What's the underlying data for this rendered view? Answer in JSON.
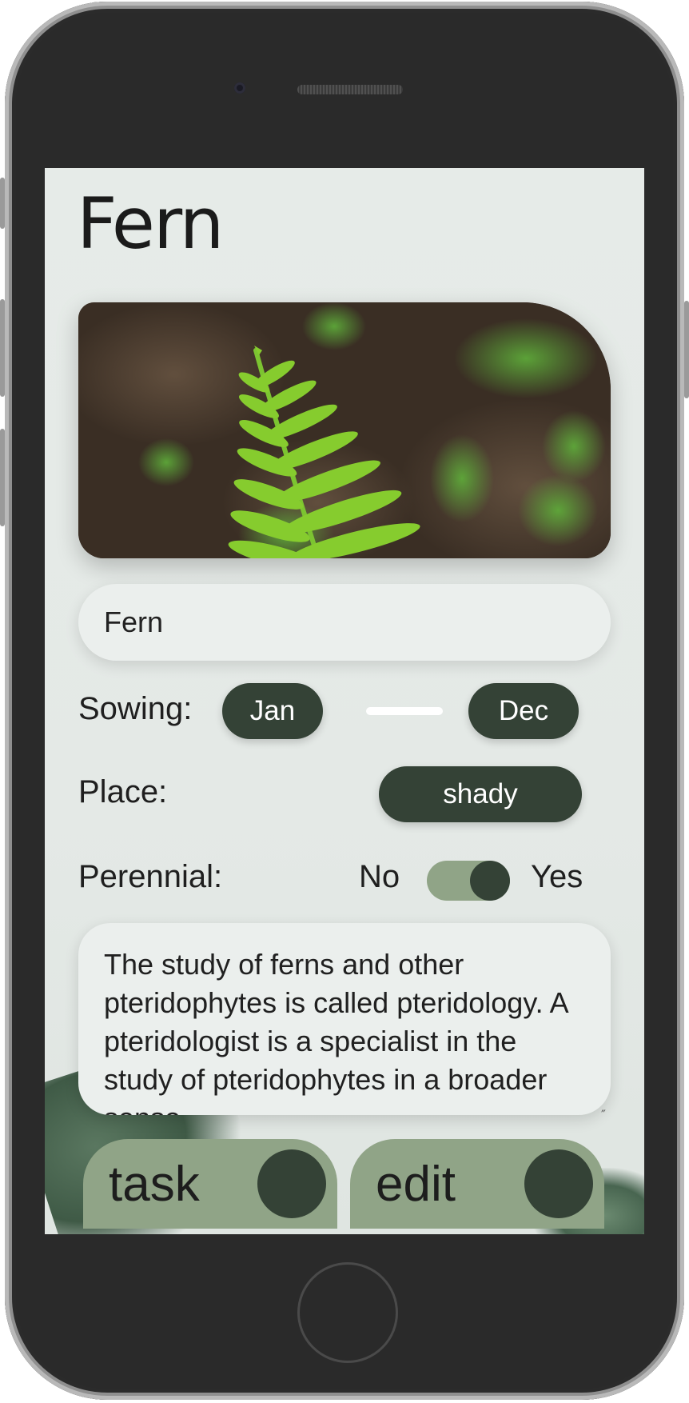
{
  "page": {
    "title": "Fern",
    "name_value": "Fern",
    "sowing": {
      "label": "Sowing:",
      "from": "Jan",
      "to": "Dec"
    },
    "place": {
      "label": "Place:",
      "value": "shady"
    },
    "perennial": {
      "label": "Perennial:",
      "off_label": "No",
      "on_label": "Yes",
      "checked": true
    },
    "description": "The study of ferns and other pteridophytes is called pteridology. A pteridologist is a specialist in the study of pteridophytes in a broader sense",
    "actions": {
      "task_label": "task",
      "edit_label": "edit"
    }
  },
  "colors": {
    "accent_dark": "#344236",
    "accent_light": "#90a487",
    "background": "#e6ebe8"
  },
  "icons": {
    "photo": "fern-photo"
  }
}
